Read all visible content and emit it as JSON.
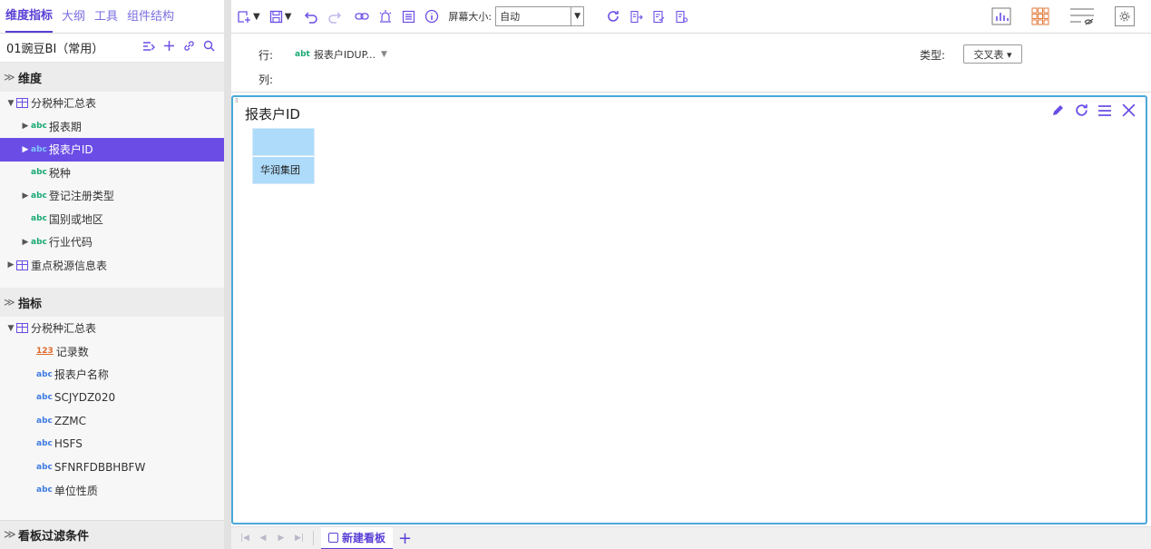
{
  "left_tabs": [
    "维度指标",
    "大纲",
    "工具",
    "组件结构"
  ],
  "project": {
    "name": "01豌豆BI（常用）"
  },
  "dimensions": {
    "header": "维度",
    "items": [
      {
        "label": "分税种汇总表",
        "kind": "table",
        "expand": "down"
      },
      {
        "label": "报表期",
        "kind": "abc",
        "expand": "right"
      },
      {
        "label": "报表户ID",
        "kind": "abc",
        "expand": "right",
        "selected": true
      },
      {
        "label": "税种",
        "kind": "abc",
        "expand": ""
      },
      {
        "label": "登记注册类型",
        "kind": "abc",
        "expand": "right"
      },
      {
        "label": "国别或地区",
        "kind": "abc",
        "expand": ""
      },
      {
        "label": "行业代码",
        "kind": "abc",
        "expand": "right"
      },
      {
        "label": "重点税源信息表",
        "kind": "table",
        "expand": "right"
      }
    ]
  },
  "measures": {
    "header": "指标",
    "items": [
      {
        "label": "分税种汇总表",
        "kind": "table",
        "expand": "down"
      },
      {
        "label": "记录数",
        "kind": "123"
      },
      {
        "label": "报表户名称",
        "kind": "abc"
      },
      {
        "label": "SCJYDZ020",
        "kind": "abc"
      },
      {
        "label": "ZZMC",
        "kind": "abc"
      },
      {
        "label": "HSFS",
        "kind": "abc"
      },
      {
        "label": "SFNRFDBBHBFW",
        "kind": "abc"
      },
      {
        "label": "单位性质",
        "kind": "abc"
      }
    ]
  },
  "filter_header": "看板过滤条件",
  "toolbar": {
    "screen_size_label": "屏幕大小:",
    "screen_size_value": "自动"
  },
  "rowbar": {
    "row_label": "行:",
    "row_field": "报表户IDUP...",
    "col_label": "列:",
    "type_label": "类型:",
    "type_value": "交叉表 ▾"
  },
  "widget": {
    "title": "报表户ID",
    "cells": [
      "",
      "华润集团"
    ]
  },
  "bottom": {
    "board_tab": "新建看板"
  }
}
